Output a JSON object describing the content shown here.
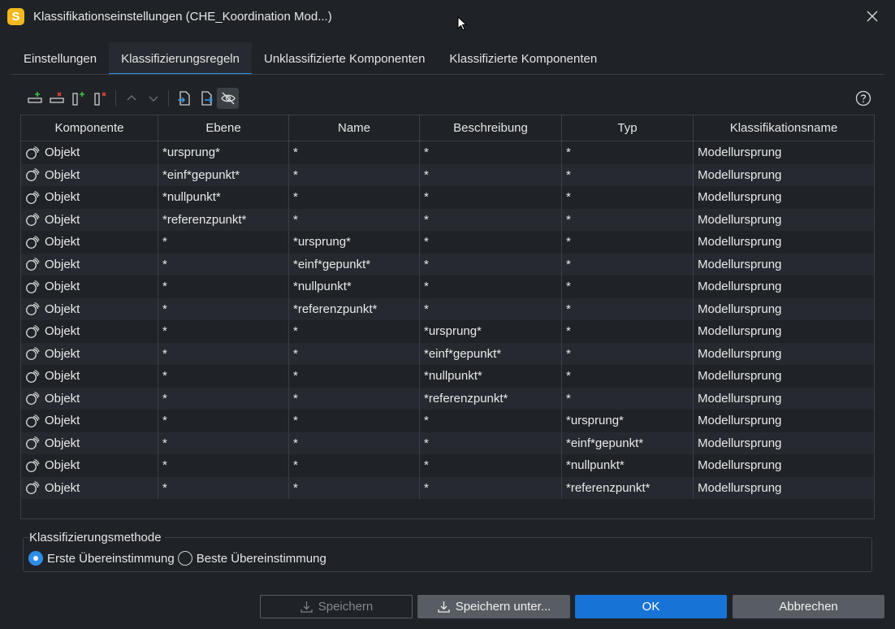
{
  "window": {
    "title": "Klassifikationseinstellungen (CHE_Koordination Mod...)",
    "logo_letter": "S"
  },
  "tabs": [
    {
      "label": "Einstellungen",
      "active": false
    },
    {
      "label": "Klassifizierungsregeln",
      "active": true
    },
    {
      "label": "Unklassifizierte Komponenten",
      "active": false
    },
    {
      "label": "Klassifizierte Komponenten",
      "active": false
    }
  ],
  "toolbar": {
    "buttons": [
      "add-row-icon",
      "remove-row-icon",
      "add-column-icon",
      "remove-column-icon",
      "move-up-icon",
      "move-down-icon",
      "import-icon",
      "export-icon",
      "hide-icon"
    ],
    "help_icon": "help-icon"
  },
  "table": {
    "headers": [
      "Komponente",
      "Ebene",
      "Name",
      "Beschreibung",
      "Typ",
      "Klassifikationsname"
    ],
    "rows": [
      [
        "Objekt",
        "*ursprung*",
        "*",
        "*",
        "*",
        "Modellursprung"
      ],
      [
        "Objekt",
        "*einf*gepunkt*",
        "*",
        "*",
        "*",
        "Modellursprung"
      ],
      [
        "Objekt",
        "*nullpunkt*",
        "*",
        "*",
        "*",
        "Modellursprung"
      ],
      [
        "Objekt",
        "*referenzpunkt*",
        "*",
        "*",
        "*",
        "Modellursprung"
      ],
      [
        "Objekt",
        "*",
        "*ursprung*",
        "*",
        "*",
        "Modellursprung"
      ],
      [
        "Objekt",
        "*",
        "*einf*gepunkt*",
        "*",
        "*",
        "Modellursprung"
      ],
      [
        "Objekt",
        "*",
        "*nullpunkt*",
        "*",
        "*",
        "Modellursprung"
      ],
      [
        "Objekt",
        "*",
        "*referenzpunkt*",
        "*",
        "*",
        "Modellursprung"
      ],
      [
        "Objekt",
        "*",
        "*",
        "*ursprung*",
        "*",
        "Modellursprung"
      ],
      [
        "Objekt",
        "*",
        "*",
        "*einf*gepunkt*",
        "*",
        "Modellursprung"
      ],
      [
        "Objekt",
        "*",
        "*",
        "*nullpunkt*",
        "*",
        "Modellursprung"
      ],
      [
        "Objekt",
        "*",
        "*",
        "*referenzpunkt*",
        "*",
        "Modellursprung"
      ],
      [
        "Objekt",
        "*",
        "*",
        "*",
        "*ursprung*",
        "Modellursprung"
      ],
      [
        "Objekt",
        "*",
        "*",
        "*",
        "*einf*gepunkt*",
        "Modellursprung"
      ],
      [
        "Objekt",
        "*",
        "*",
        "*",
        "*nullpunkt*",
        "Modellursprung"
      ],
      [
        "Objekt",
        "*",
        "*",
        "*",
        "*referenzpunkt*",
        "Modellursprung"
      ]
    ]
  },
  "method": {
    "legend": "Klassifizierungsmethode",
    "options": [
      {
        "label": "Erste Übereinstimmung",
        "checked": true
      },
      {
        "label": "Beste Übereinstimmung",
        "checked": false
      }
    ]
  },
  "buttons": {
    "save": "Speichern",
    "save_as": "Speichern unter...",
    "ok": "OK",
    "cancel": "Abbrechen"
  },
  "colors": {
    "accent": "#2e8de6",
    "ok_button": "#1773d6",
    "background": "#1f2227",
    "logo": "#f2b81c"
  }
}
